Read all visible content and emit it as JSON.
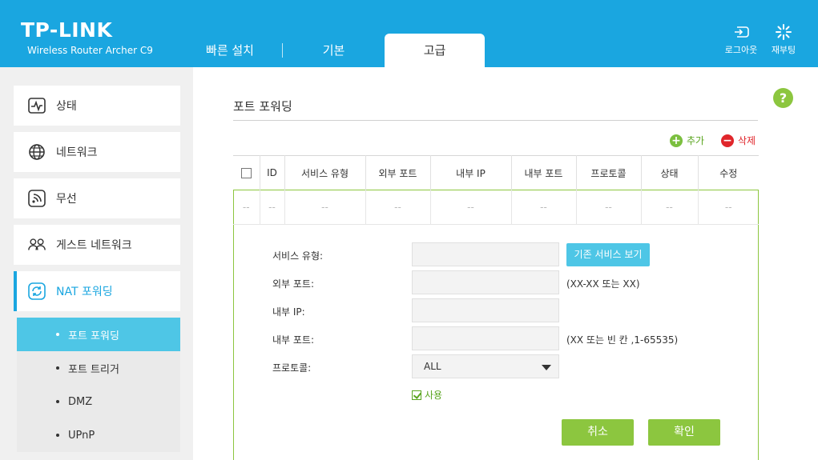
{
  "header": {
    "brand": "TP-LINK",
    "model": "Wireless Router Archer C9",
    "tabs": [
      {
        "label": "빠른 설치"
      },
      {
        "label": "기본"
      },
      {
        "label": "고급"
      }
    ],
    "logout_label": "로그아웃",
    "reboot_label": "재부팅",
    "bg_color": "#1aa6e0"
  },
  "sidebar": {
    "items": [
      {
        "label": "상태",
        "icon": "pulse-icon"
      },
      {
        "label": "네트워크",
        "icon": "globe-icon"
      },
      {
        "label": "무선",
        "icon": "wireless-icon"
      },
      {
        "label": "게스트 네트워크",
        "icon": "guest-users-icon"
      },
      {
        "label": "NAT 포워딩",
        "icon": "refresh-icon"
      }
    ],
    "sub_items": [
      {
        "label": "포트 포워딩"
      },
      {
        "label": "포트 트리거"
      },
      {
        "label": "DMZ"
      },
      {
        "label": "UPnP"
      }
    ]
  },
  "main": {
    "help": "?",
    "title": "포트 포워딩",
    "add_label": "추가",
    "delete_label": "삭제",
    "table": {
      "headers": [
        "ID",
        "서비스 유형",
        "외부 포트",
        "내부 IP",
        "내부 포트",
        "프로토콜",
        "상태",
        "수정"
      ],
      "row": [
        "--",
        "--",
        "--",
        "--",
        "--",
        "--",
        "--",
        "--",
        "--"
      ]
    },
    "form": {
      "service_type_label": "서비스 유형:",
      "existing_services_button": "기존 서비스 보기",
      "external_port_label": "외부 포트:",
      "external_port_hint": "(XX-XX 또는 XX)",
      "internal_ip_label": "내부 IP:",
      "internal_port_label": "내부 포트:",
      "internal_port_hint": "(XX 또는 빈 칸 ,1-65535)",
      "protocol_label": "프로토콜:",
      "protocol_value": "ALL",
      "enable_label": "사용",
      "cancel_label": "취소",
      "ok_label": "확인"
    },
    "accent_green": "#8cc63f",
    "accent_blue": "#4ec6e6"
  }
}
